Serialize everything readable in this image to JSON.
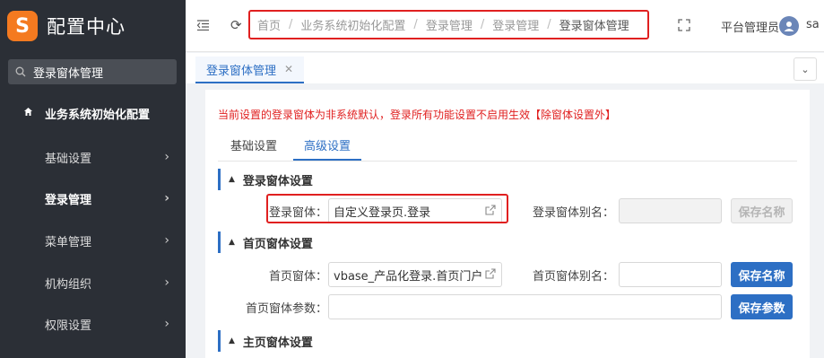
{
  "app": {
    "logo_letter": "S",
    "title": "配置中心",
    "accent": "#2d6fc4",
    "logo_color": "#f47a20"
  },
  "sidebar": {
    "search_value": "登录窗体管理",
    "parent_label": "业务系统初始化配置",
    "items": [
      {
        "label": "基础设置"
      },
      {
        "label": "登录管理"
      },
      {
        "label": "菜单管理"
      },
      {
        "label": "机构组织"
      },
      {
        "label": "权限设置"
      }
    ]
  },
  "header": {
    "breadcrumb": [
      "首页",
      "业务系统初始化配置",
      "登录管理",
      "登录管理",
      "登录窗体管理"
    ],
    "separator": "/",
    "user_name": "平台管理员",
    "user_id": "sa"
  },
  "tabstrip": {
    "tab_label": "登录窗体管理"
  },
  "content": {
    "notice": "当前设置的登录窗体为非系统默认，登录所有功能设置不启用生效【除窗体设置外】",
    "tabs": [
      "基础设置",
      "高级设置"
    ],
    "sections": [
      "登录窗体设置",
      "首页窗体设置",
      "主页窗体设置"
    ],
    "login_form_label": "登录窗体：",
    "login_form_value": "自定义登录页.登录",
    "login_alias_label": "登录窗体别名：",
    "login_alias_value": "",
    "save_name_label": "保存名称",
    "home_form_label": "首页窗体：",
    "home_form_value": "vbase_产品化登录.首页门户",
    "home_alias_label": "首页窗体别名：",
    "home_alias_value": "",
    "home_params_label": "首页窗体参数：",
    "home_params_value": "",
    "save_params_label": "保存参数"
  }
}
